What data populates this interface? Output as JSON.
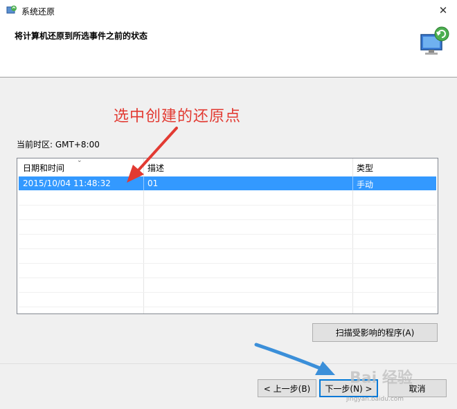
{
  "window": {
    "title": "系统还原",
    "close_glyph": "✕"
  },
  "header": {
    "title": "将计算机还原到所选事件之前的状态"
  },
  "annotation": {
    "text": "选中创建的还原点",
    "color": "#e23a32"
  },
  "timezone": {
    "label": "当前时区: GMT+8:00"
  },
  "list": {
    "columns": [
      "日期和时间",
      "描述",
      "类型"
    ],
    "rows": [
      {
        "date": "2015/10/04 11:48:32",
        "description": "01",
        "type": "手动",
        "selected": true
      }
    ]
  },
  "buttons": {
    "scan": "扫描受影响的程序(A)",
    "back": "< 上一步(B)",
    "next": "下一步(N) >",
    "cancel": "取消"
  },
  "watermark": {
    "text": "Bai 经验",
    "sub": "jingyan.baidu.com"
  },
  "colors": {
    "selection": "#3399ff",
    "arrow_red": "#e23a32",
    "arrow_blue": "#3b8fd9"
  }
}
